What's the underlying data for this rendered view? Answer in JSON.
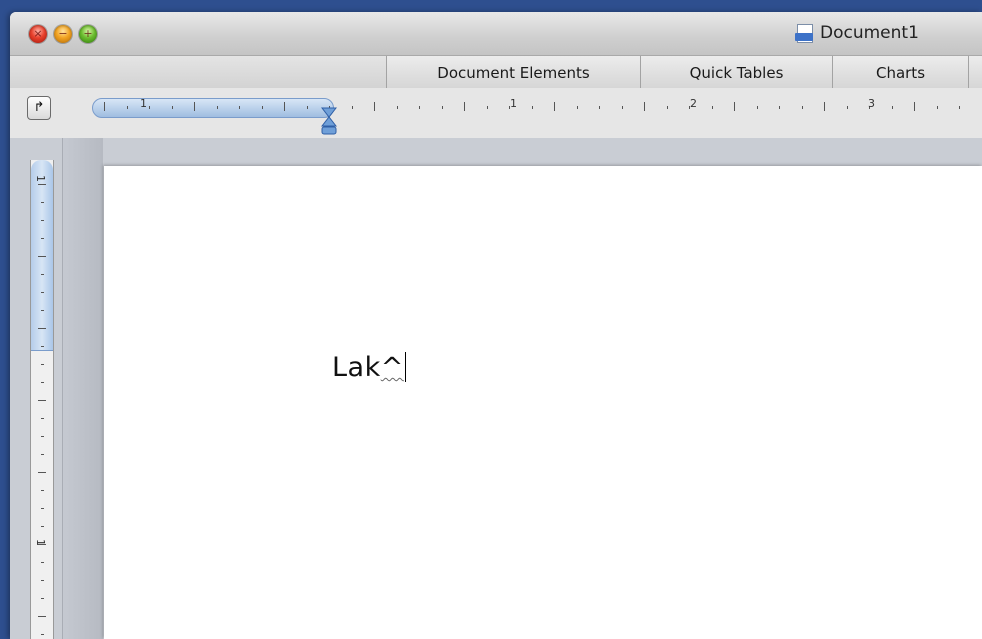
{
  "window": {
    "title": "Document1",
    "title_icon": "docx-document-icon",
    "controls": [
      {
        "name": "close",
        "glyph": "×"
      },
      {
        "name": "minimize",
        "glyph": "−"
      },
      {
        "name": "zoom",
        "glyph": "+"
      }
    ]
  },
  "ribbon": {
    "tabs": [
      "Document Elements",
      "Quick Tables",
      "Charts"
    ]
  },
  "ruler": {
    "tab_selector_glyph": "↱",
    "horizontal_labels": [
      "1",
      "1",
      "2",
      "3"
    ],
    "vertical_labels": [
      "1",
      "1"
    ]
  },
  "document": {
    "text_main": "Lak",
    "text_misspelled": "^"
  },
  "colors": {
    "desktop": "#2e4f8f",
    "ruler_margin": "#9fbde0",
    "page": "#ffffff"
  }
}
